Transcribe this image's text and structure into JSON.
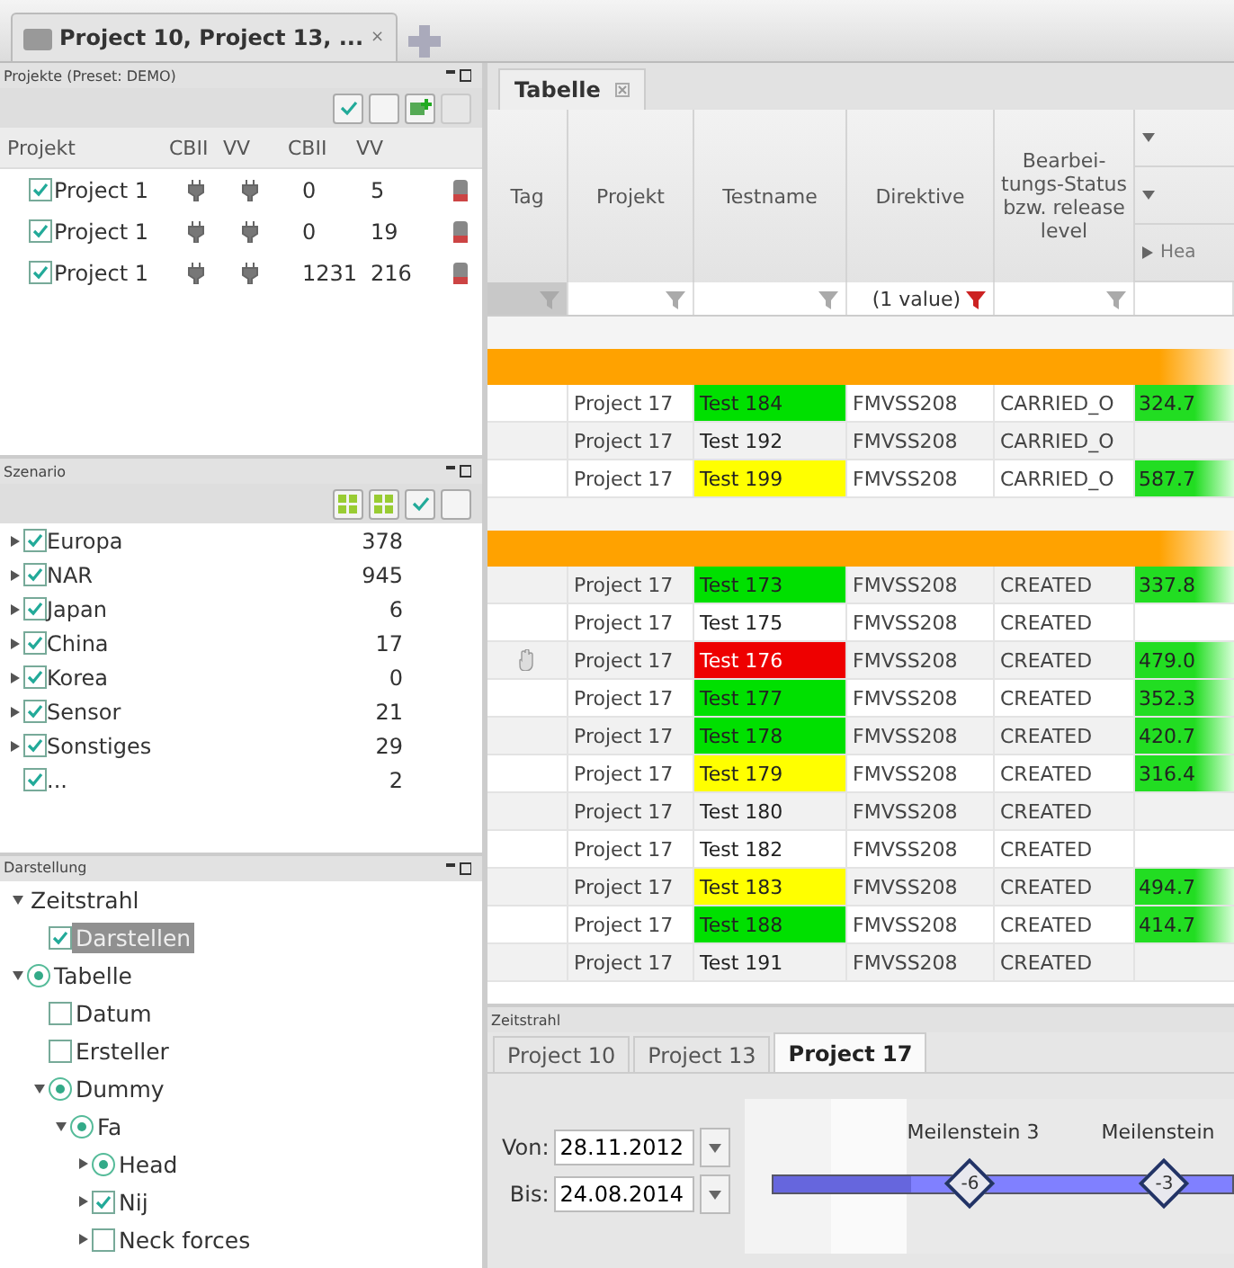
{
  "document_tab": {
    "title": "Project 10, Project 13, ...",
    "close": "×"
  },
  "projects_panel": {
    "title": "Projekte (Preset: DEMO)",
    "columns": [
      "Projekt",
      "CBII",
      "VV",
      "CBII",
      "VV"
    ],
    "rows": [
      {
        "name": "Project 1",
        "checked": true,
        "values": [
          "0",
          "5"
        ]
      },
      {
        "name": "Project 1",
        "checked": true,
        "values": [
          "0",
          "19"
        ]
      },
      {
        "name": "Project 1",
        "checked": true,
        "values": [
          "1231",
          "216"
        ]
      }
    ]
  },
  "scenario_panel": {
    "title": "Szenario",
    "items": [
      {
        "label": "Europa",
        "checked": true,
        "expandable": true,
        "count": "378"
      },
      {
        "label": "NAR",
        "checked": true,
        "expandable": true,
        "count": "945"
      },
      {
        "label": "Japan",
        "checked": true,
        "expandable": true,
        "count": "6"
      },
      {
        "label": "China",
        "checked": true,
        "expandable": true,
        "count": "17"
      },
      {
        "label": "Korea",
        "checked": true,
        "expandable": true,
        "count": "0"
      },
      {
        "label": "Sensor",
        "checked": true,
        "expandable": true,
        "count": "21"
      },
      {
        "label": "Sonstiges",
        "checked": true,
        "expandable": true,
        "count": "29"
      },
      {
        "label": "...",
        "checked": true,
        "expandable": false,
        "count": "2"
      }
    ]
  },
  "display_panel": {
    "title": "Darstellung",
    "tree": [
      {
        "label": "Zeitstrahl",
        "kind": "group",
        "expanded": true,
        "children": [
          {
            "label": "Darstellen",
            "kind": "checkbox",
            "checked": true,
            "selected": true
          }
        ]
      },
      {
        "label": "Tabelle",
        "kind": "radio",
        "checked": true,
        "expanded": true,
        "children": [
          {
            "label": "Datum",
            "kind": "checkbox",
            "checked": false,
            "selected": false
          },
          {
            "label": "Ersteller",
            "kind": "checkbox",
            "checked": false,
            "selected": false
          },
          {
            "label": "Dummy",
            "kind": "radio",
            "checked": true,
            "expanded": true,
            "children": [
              {
                "label": "Fa",
                "kind": "radio",
                "checked": true,
                "expanded": true,
                "children": [
                  {
                    "label": "Head",
                    "kind": "radio",
                    "checked": true,
                    "expanded": false
                  },
                  {
                    "label": "Nij",
                    "kind": "checkbox",
                    "checked": true,
                    "expanded": false
                  },
                  {
                    "label": "Neck forces",
                    "kind": "checkbox",
                    "checked": false,
                    "expanded": false
                  }
                ]
              }
            ]
          }
        ]
      }
    ]
  },
  "table_tab": {
    "title": "Tabelle"
  },
  "table": {
    "columns": [
      "Tag",
      "Projekt",
      "Testname",
      "Direktive",
      "Bearbei-tungs-Status bzw. release level"
    ],
    "extra_header": "Hea",
    "filters": [
      {
        "active": false
      },
      {
        "active": false
      },
      {
        "active": false
      },
      {
        "text": "(1 value)",
        "active": true
      },
      {
        "active": false
      }
    ],
    "groups": [
      {
        "rows": [
          {
            "tagged": false,
            "project": "Project 17",
            "test": "Test 184",
            "color": "#00e000",
            "directive": "FMVSS208",
            "status": "CARRIED_O",
            "value": "324.7"
          },
          {
            "tagged": false,
            "project": "Project 17",
            "test": "Test 192",
            "directive": "FMVSS208",
            "status": "CARRIED_O"
          },
          {
            "tagged": false,
            "project": "Project 17",
            "test": "Test 199",
            "color": "#ffff00",
            "directive": "FMVSS208",
            "status": "CARRIED_O",
            "value": "587.7"
          }
        ]
      },
      {
        "rows": [
          {
            "tagged": false,
            "project": "Project 17",
            "test": "Test 173",
            "color": "#00e000",
            "directive": "FMVSS208",
            "status": "CREATED",
            "value": "337.8"
          },
          {
            "tagged": false,
            "project": "Project 17",
            "test": "Test 175",
            "directive": "FMVSS208",
            "status": "CREATED"
          },
          {
            "tagged": true,
            "project": "Project 17",
            "test": "Test 176",
            "color": "#ee0000",
            "directive": "FMVSS208",
            "status": "CREATED",
            "value": "479.0"
          },
          {
            "tagged": false,
            "project": "Project 17",
            "test": "Test 177",
            "color": "#00e000",
            "directive": "FMVSS208",
            "status": "CREATED",
            "value": "352.3"
          },
          {
            "tagged": false,
            "project": "Project 17",
            "test": "Test 178",
            "color": "#00e000",
            "directive": "FMVSS208",
            "status": "CREATED",
            "value": "420.7"
          },
          {
            "tagged": false,
            "project": "Project 17",
            "test": "Test 179",
            "color": "#ffff00",
            "directive": "FMVSS208",
            "status": "CREATED",
            "value": "316.4"
          },
          {
            "tagged": false,
            "project": "Project 17",
            "test": "Test 180",
            "directive": "FMVSS208",
            "status": "CREATED"
          },
          {
            "tagged": false,
            "project": "Project 17",
            "test": "Test 182",
            "directive": "FMVSS208",
            "status": "CREATED"
          },
          {
            "tagged": false,
            "project": "Project 17",
            "test": "Test 183",
            "color": "#ffff00",
            "directive": "FMVSS208",
            "status": "CREATED",
            "value": "494.7"
          },
          {
            "tagged": false,
            "project": "Project 17",
            "test": "Test 188",
            "color": "#00e000",
            "directive": "FMVSS208",
            "status": "CREATED",
            "value": "414.7"
          },
          {
            "tagged": false,
            "project": "Project 17",
            "test": "Test 191",
            "directive": "FMVSS208",
            "status": "CREATED"
          }
        ]
      }
    ]
  },
  "timeline": {
    "title": "Zeitstrahl",
    "tabs": [
      {
        "label": "Project 10",
        "selected": false
      },
      {
        "label": "Project 13",
        "selected": false
      },
      {
        "label": "Project 17",
        "selected": true
      }
    ],
    "from_label": "Von:",
    "from": "28.11.2012",
    "to_label": "Bis:",
    "to": "24.08.2014",
    "milestones": [
      {
        "label": "Meilenstein 3",
        "value": "-6"
      },
      {
        "label": "Meilenstein",
        "value": "-3"
      }
    ]
  }
}
